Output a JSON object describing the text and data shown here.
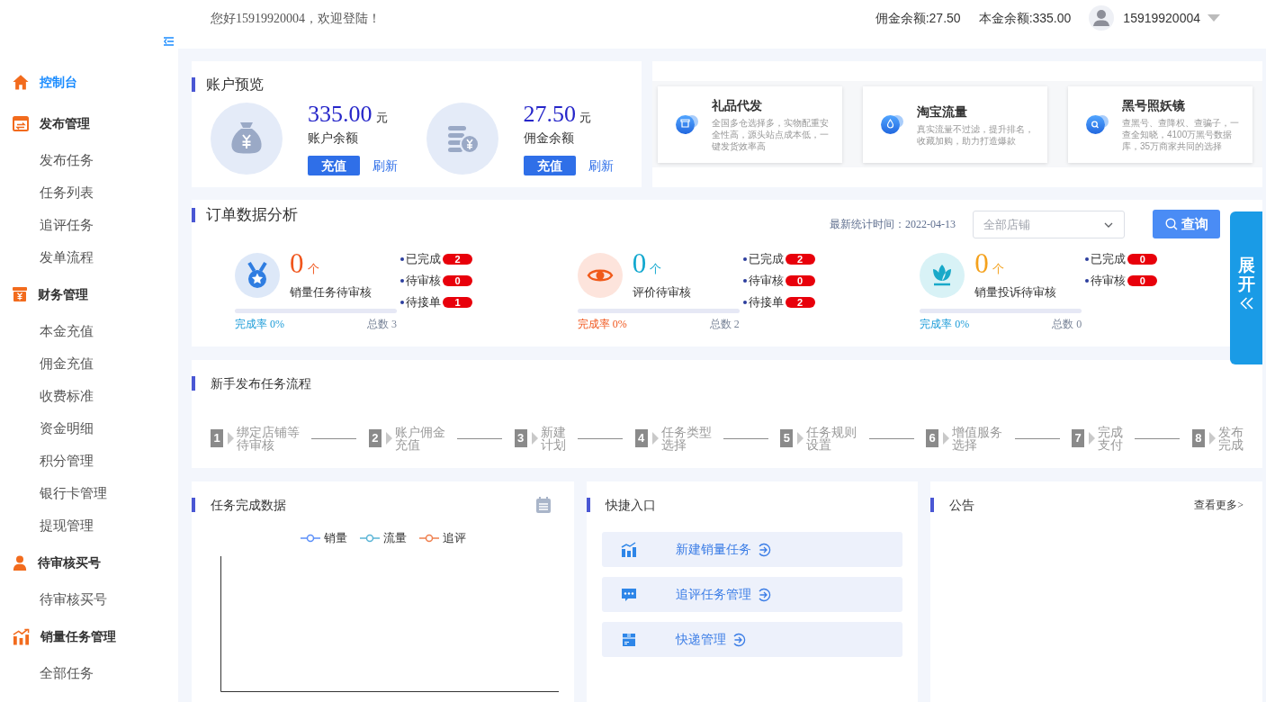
{
  "header": {
    "greeting": "您好15919920004，欢迎登陆！",
    "commission_balance": "佣金余额:27.50",
    "principal_balance": "本金余额:335.00",
    "username": "15919920004"
  },
  "sidebar": {
    "groups": [
      {
        "label": "控制台",
        "kind": "home",
        "selected": true
      },
      {
        "label": "发布管理",
        "kind": "publish",
        "selected": false,
        "children": [
          {
            "label": "发布任务",
            "selected": false
          },
          {
            "label": "任务列表",
            "selected": false
          },
          {
            "label": "追评任务",
            "selected": false
          },
          {
            "label": "发单流程",
            "selected": false
          }
        ]
      },
      {
        "label": "财务管理",
        "kind": "finance",
        "selected": false,
        "children": [
          {
            "label": "本金充值",
            "selected": false
          },
          {
            "label": "佣金充值",
            "selected": false
          },
          {
            "label": "收费标准",
            "selected": false
          },
          {
            "label": "资金明细",
            "selected": false
          },
          {
            "label": "积分管理",
            "selected": false
          },
          {
            "label": "银行卡管理",
            "selected": false
          },
          {
            "label": "提现管理",
            "selected": false
          }
        ]
      },
      {
        "label": "待审核买号",
        "kind": "user",
        "selected": false,
        "children": [
          {
            "label": "待审核买号",
            "selected": false
          }
        ]
      },
      {
        "label": "销量任务管理",
        "kind": "chart",
        "selected": false,
        "children": [
          {
            "label": "全部任务",
            "selected": false
          }
        ]
      }
    ]
  },
  "account_overview": {
    "title": "账户预览",
    "balances": [
      {
        "kind": "bag",
        "amount": "335.00",
        "unit": "元",
        "label": "账户余额",
        "recharge_button": "充值",
        "refresh_link": "刷新"
      },
      {
        "kind": "coins",
        "amount": "27.50",
        "unit": "元",
        "label": "佣金余额",
        "recharge_button": "充值",
        "refresh_link": "刷新"
      }
    ]
  },
  "promos": [
    {
      "kind": "gift",
      "title": "礼品代发",
      "description": "全国多仓选择多，实物配重安全性高，源头站点成本低，一键发货效率高"
    },
    {
      "kind": "drop",
      "title": "淘宝流量",
      "description": "真实流量不过滤，提升排名，收藏加购，助力打造爆款"
    },
    {
      "kind": "search",
      "title": "黑号照妖镜",
      "description": "查黑号、查降权、查骗子，一查全知晓，4100万黑号数据库，35万商家共同的选择"
    }
  ],
  "order_analysis": {
    "title": "订单数据分析",
    "updated": "最新统计时间：2022-04-13",
    "store_select": {
      "placeholder": "全部店铺"
    },
    "query_button": "查询",
    "stats": [
      {
        "kind": "medal",
        "count": "0",
        "unit": "个",
        "label": "销量任务待审核",
        "color": "#f0561d",
        "badges": [
          {
            "label": "已完成",
            "count": "2"
          },
          {
            "label": "待审核",
            "count": "0"
          },
          {
            "label": "待接单",
            "count": "1"
          }
        ],
        "level": 0,
        "rate": "完成率 0%",
        "total": "总数 3"
      },
      {
        "kind": "eye",
        "count": "0",
        "unit": "个",
        "label": "评价待审核",
        "color": "#12a8cf",
        "badges": [
          {
            "label": "已完成",
            "count": "2"
          },
          {
            "label": "待审核",
            "count": "0"
          },
          {
            "label": "待接单",
            "count": "2"
          }
        ],
        "level": 0,
        "rate": "完成率 0%",
        "total": "总数 2"
      },
      {
        "kind": "lotus",
        "count": "0",
        "unit": "个",
        "label": "销量投诉待审核",
        "color": "#f4a11c",
        "badges": [
          {
            "label": "已完成",
            "count": "0"
          },
          {
            "label": "待审核",
            "count": "0"
          }
        ],
        "level": 0,
        "rate": "完成率 0%",
        "total": "总数 0"
      }
    ]
  },
  "expand_tab": {
    "label": "展开"
  },
  "process": {
    "title": "新手发布任务流程",
    "steps": [
      {
        "number": "1",
        "lines": [
          "绑定店铺等",
          "待审核"
        ]
      },
      {
        "number": "2",
        "lines": [
          "账户佣金",
          "充值"
        ]
      },
      {
        "number": "3",
        "lines": [
          "新建",
          "计划"
        ]
      },
      {
        "number": "4",
        "lines": [
          "任务类型",
          "选择"
        ]
      },
      {
        "number": "5",
        "lines": [
          "任务规则",
          "设置"
        ]
      },
      {
        "number": "6",
        "lines": [
          "增值服务",
          "选择"
        ]
      },
      {
        "number": "7",
        "lines": [
          "完成",
          "支付"
        ]
      },
      {
        "number": "8",
        "lines": [
          "发布",
          "完成"
        ]
      }
    ]
  },
  "task_data": {
    "title": "任务完成数据",
    "legend": [
      {
        "name": "销量",
        "color": "#5b8ff9"
      },
      {
        "name": "流量",
        "color": "#5ab4d6"
      },
      {
        "name": "追评",
        "color": "#ef7f4e"
      }
    ]
  },
  "shortcuts": {
    "title": "快捷入口",
    "items": [
      {
        "kind": "chart",
        "label": "新建销量任务"
      },
      {
        "kind": "chat",
        "label": "追评任务管理"
      },
      {
        "kind": "box",
        "label": "快递管理"
      }
    ]
  },
  "notices": {
    "title": "公告",
    "more_link": "查看更多>"
  }
}
